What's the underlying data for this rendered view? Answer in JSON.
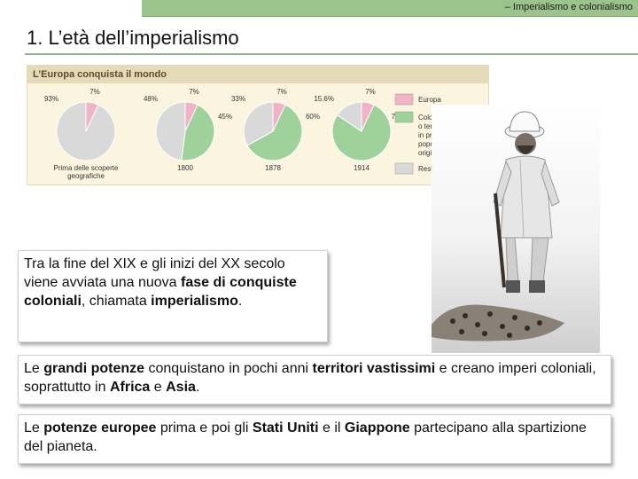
{
  "header": {
    "section_label": "– Imperialismo e colonialismo"
  },
  "page": {
    "title": "1. L’età dell’imperialismo"
  },
  "colors": {
    "europe": "#f0b3c7",
    "colonies": "#9fd19a",
    "rest": "#d9d9d9",
    "header_bar": "#9bc48d"
  },
  "chart_data": {
    "type": "pie",
    "title": "L’Europa conquista il mondo",
    "legend": [
      "Europa",
      "Colonie europee o territori abitati in prevalenza da popolazioni di origine europea",
      "Resto del mondo"
    ],
    "legend_position": "right",
    "pies": [
      {
        "label": "Prima delle scoperte geografiche",
        "europa": 7,
        "colonie": 0,
        "resto": 93,
        "labels": [
          "93%",
          "7%"
        ]
      },
      {
        "label": "1800",
        "europa": 7,
        "colonie": 45,
        "resto": 48,
        "labels": [
          "48%",
          "7%",
          "45%"
        ]
      },
      {
        "label": "1878",
        "europa": 7,
        "colonie": 60,
        "resto": 33,
        "labels": [
          "33%",
          "7%",
          "60%"
        ]
      },
      {
        "label": "1914",
        "europa": 7,
        "colonie": 77.4,
        "resto": 15.6,
        "labels": [
          "15.6%",
          "7%",
          "77,4%"
        ]
      }
    ]
  },
  "boxes": {
    "box1": {
      "t1": "Tra la fine del XIX e gli inizi del XX secolo viene avviata una nuova ",
      "b1": "fase di conquiste coloniali",
      "t2": ", chiamata ",
      "b2": "imperialismo",
      "t3": "."
    },
    "box2": {
      "t1": "Le ",
      "b1": "grandi potenze",
      "t2": " conquistano in pochi anni ",
      "b2": "territori vastissimi",
      "t3": " e creano imperi coloniali, soprattutto in ",
      "b3": "Africa",
      "t4": " e ",
      "b4": "Asia",
      "t5": "."
    },
    "box3": {
      "t1": "Le ",
      "b1": "potenze europee",
      "t2": " prima e poi gli ",
      "b2": "Stati Uniti",
      "t3": " e il ",
      "b3": "Giappone",
      "t4": " partecipano alla spartizione del pianeta."
    }
  }
}
